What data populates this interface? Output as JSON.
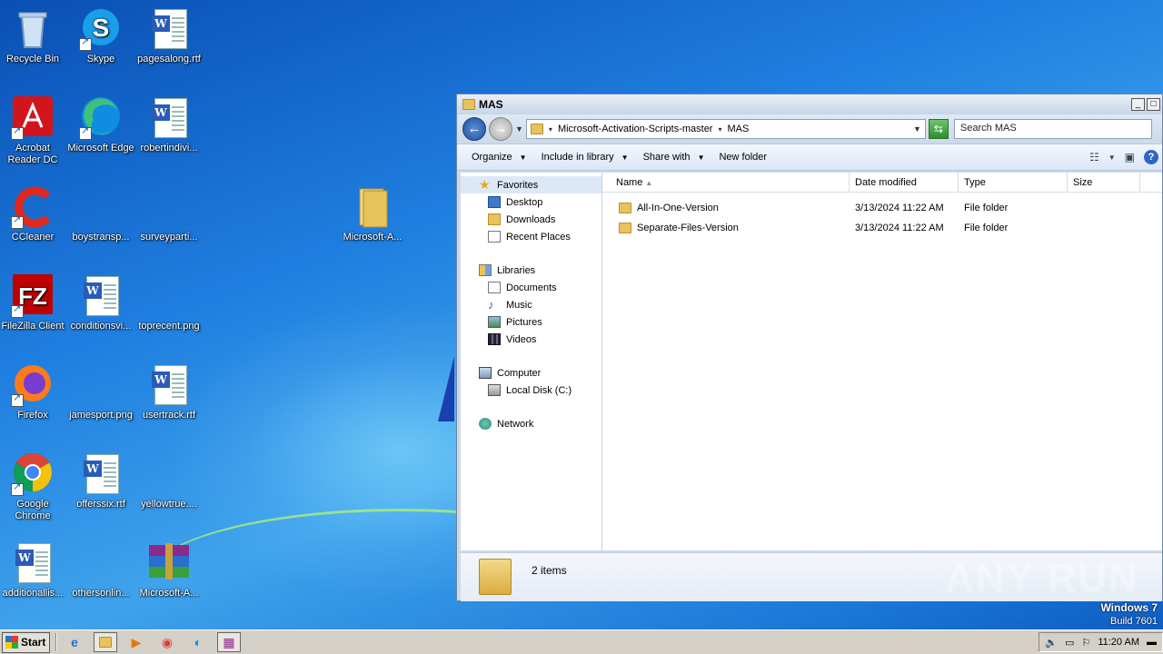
{
  "desktop": {
    "icons": [
      {
        "label": "Recycle Bin"
      },
      {
        "label": "Skype"
      },
      {
        "label": "pagesalong.rtf"
      },
      {
        "label": "Acrobat Reader DC"
      },
      {
        "label": "Microsoft Edge"
      },
      {
        "label": "robertindivi..."
      },
      {
        "label": "CCleaner"
      },
      {
        "label": "boystransp..."
      },
      {
        "label": "surveyparti..."
      },
      {
        "label": "Microsoft-A..."
      },
      {
        "label": "FileZilla Client"
      },
      {
        "label": "conditionsvi..."
      },
      {
        "label": "toprecent.png"
      },
      {
        "label": "Firefox"
      },
      {
        "label": "jamesport.png"
      },
      {
        "label": "usertrack.rtf"
      },
      {
        "label": "Google Chrome"
      },
      {
        "label": "offerssix.rtf"
      },
      {
        "label": "yellowtrue...."
      },
      {
        "label": "additionallis..."
      },
      {
        "label": "othersonlin..."
      },
      {
        "label": "Microsoft-A..."
      }
    ]
  },
  "window": {
    "title": "MAS",
    "address": {
      "segment1": "Microsoft-Activation-Scripts-master",
      "segment2": "MAS"
    },
    "search_placeholder": "Search MAS",
    "toolbar": {
      "organize": "Organize",
      "include_in_library": "Include in library",
      "share_with": "Share with",
      "new_folder": "New folder"
    },
    "nav": {
      "favorites": "Favorites",
      "desktop": "Desktop",
      "downloads": "Downloads",
      "recent_places": "Recent Places",
      "libraries": "Libraries",
      "documents": "Documents",
      "music": "Music",
      "pictures": "Pictures",
      "videos": "Videos",
      "computer": "Computer",
      "local_disk": "Local Disk (C:)",
      "network": "Network"
    },
    "columns": {
      "name": "Name",
      "date": "Date modified",
      "type": "Type",
      "size": "Size"
    },
    "files": [
      {
        "name": "All-In-One-Version",
        "date": "3/13/2024 11:22 AM",
        "type": "File folder"
      },
      {
        "name": "Separate-Files-Version",
        "date": "3/13/2024 11:22 AM",
        "type": "File folder"
      }
    ],
    "status": "2 items"
  },
  "watermark": {
    "text": "ANY RUN"
  },
  "os": {
    "name": "Windows 7",
    "build": "Build 7601"
  },
  "taskbar": {
    "start": "Start",
    "time": "11:20 AM"
  }
}
